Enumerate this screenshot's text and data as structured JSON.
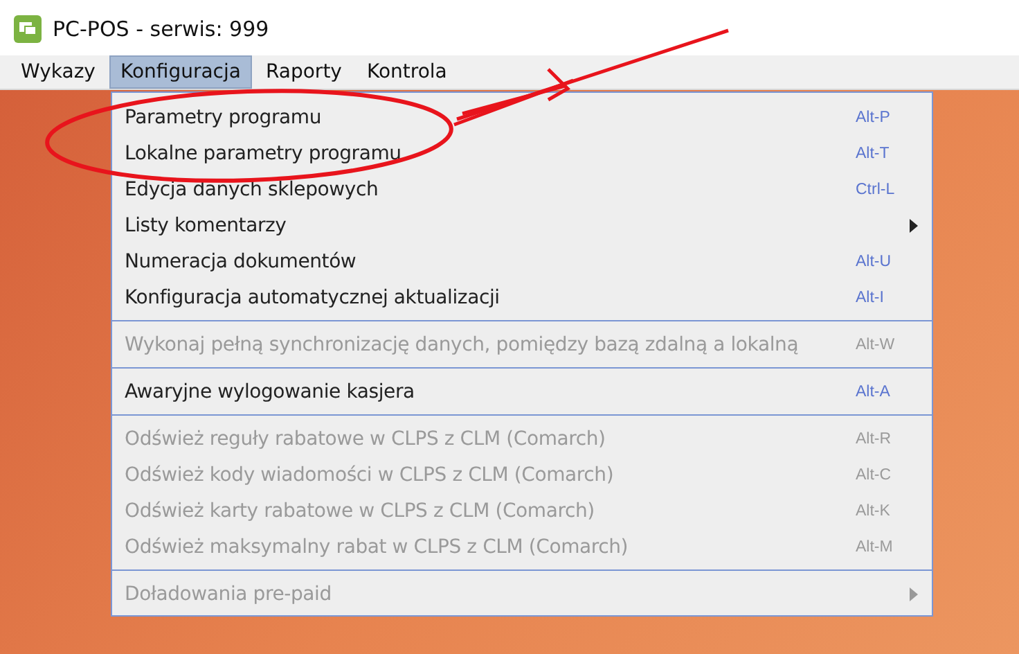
{
  "window": {
    "title": "PC-POS - serwis: 999"
  },
  "menubar": [
    {
      "label": "Wykazy",
      "selected": false
    },
    {
      "label": "Konfiguracja",
      "selected": true
    },
    {
      "label": "Raporty",
      "selected": false
    },
    {
      "label": "Kontrola",
      "selected": false
    }
  ],
  "menu": [
    {
      "kind": "item",
      "label": "Parametry programu",
      "shortcut": "Alt-P",
      "disabled": false
    },
    {
      "kind": "item",
      "label": "Lokalne parametry programu",
      "shortcut": "Alt-T",
      "disabled": false
    },
    {
      "kind": "item",
      "label": "Edycja danych sklepowych",
      "shortcut": "Ctrl-L",
      "disabled": false
    },
    {
      "kind": "submenu",
      "label": "Listy komentarzy",
      "disabled": false
    },
    {
      "kind": "item",
      "label": "Numeracja dokumentów",
      "shortcut": "Alt-U",
      "disabled": false
    },
    {
      "kind": "item",
      "label": "Konfiguracja automatycznej aktualizacji",
      "shortcut": "Alt-I",
      "disabled": false
    },
    {
      "kind": "separator"
    },
    {
      "kind": "item",
      "label": "Wykonaj pełną synchronizację danych, pomiędzy bazą zdalną a lokalną",
      "shortcut": "Alt-W",
      "disabled": true
    },
    {
      "kind": "separator"
    },
    {
      "kind": "item",
      "label": "Awaryjne wylogowanie kasjera",
      "shortcut": "Alt-A",
      "disabled": false
    },
    {
      "kind": "separator"
    },
    {
      "kind": "item",
      "label": "Odśwież reguły rabatowe w CLPS z CLM (Comarch)",
      "shortcut": "Alt-R",
      "disabled": true
    },
    {
      "kind": "item",
      "label": "Odśwież kody wiadomości w CLPS z CLM (Comarch)",
      "shortcut": "Alt-C",
      "disabled": true
    },
    {
      "kind": "item",
      "label": "Odśwież karty rabatowe w CLPS z CLM (Comarch)",
      "shortcut": "Alt-K",
      "disabled": true
    },
    {
      "kind": "item",
      "label": "Odśwież maksymalny rabat w CLPS z CLM (Comarch)",
      "shortcut": "Alt-M",
      "disabled": true
    },
    {
      "kind": "separator"
    },
    {
      "kind": "submenu",
      "label": "Doładowania pre-paid",
      "disabled": true
    }
  ]
}
